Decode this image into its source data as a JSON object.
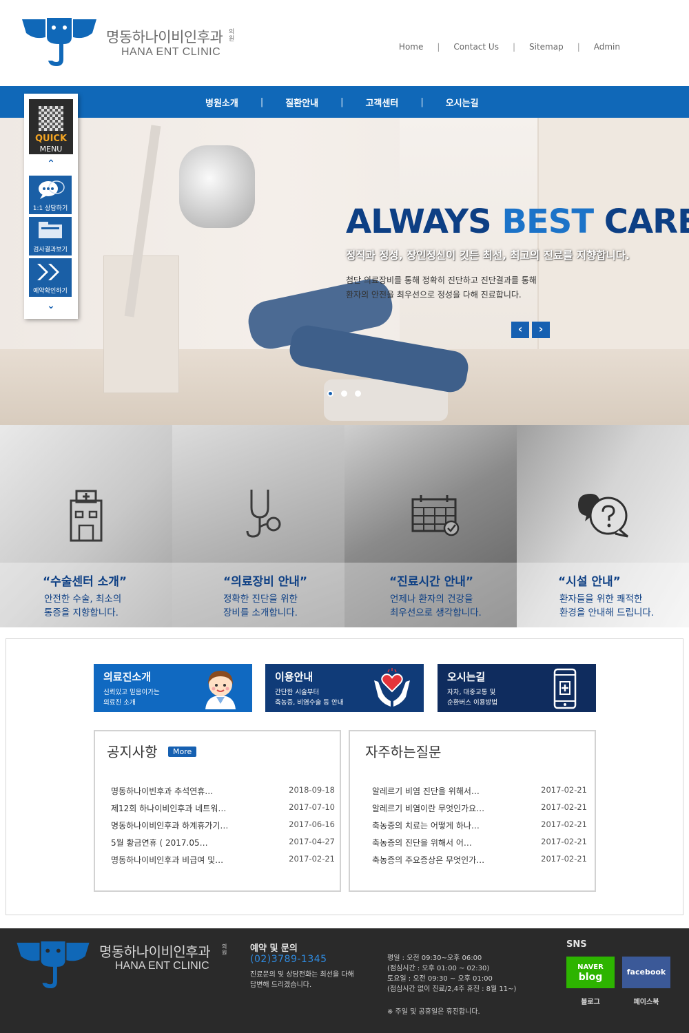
{
  "header": {
    "logo_ko": "명동하나이비인후과",
    "logo_ko_small": "의원",
    "logo_en": "HANA ENT CLINIC",
    "util_nav": [
      "Home",
      "Contact Us",
      "Sitemap",
      "Admin"
    ]
  },
  "main_nav": [
    "병원소개",
    "질환안내",
    "고객센터",
    "오시는길"
  ],
  "hero": {
    "title_part1": "ALWAYS ",
    "title_part2": "BEST",
    "title_part3": " CARE",
    "subtitle": "정직과 정성, 장인정신이 깃든 최선, 최고의 진료를 지향합니다.",
    "description": "첨단 의료장비를 통해 정확히 진단하고 진단결과를 통해\n환자의 안전을 최우선으로 정성을 다해 진료합니다.",
    "prev_icon": "chevron-left-icon",
    "next_icon": "chevron-right-icon",
    "slide_count": 3,
    "active_slide": 1
  },
  "quick_menu": {
    "title_1": "QUICK",
    "title_2": "MENU",
    "items": [
      {
        "label": "1:1 상담하기",
        "icon": "chat-bubble-icon"
      },
      {
        "label": "검사결과보기",
        "icon": "folder-icon"
      },
      {
        "label": "예약확인하기",
        "icon": "double-arrow-icon"
      }
    ]
  },
  "features": [
    {
      "title": "“수술센터 소개”",
      "desc": "안전한 수술, 최소의\n통증을 지향합니다.",
      "icon": "hospital-icon"
    },
    {
      "title": "“의료장비 안내”",
      "desc": "정확한 진단을 위한\n장비를 소개합니다.",
      "icon": "stethoscope-icon"
    },
    {
      "title": "“진료시간 안내”",
      "desc": "언제나 환자의 건강을\n최우선으로 생각합니다.",
      "icon": "calendar-icon"
    },
    {
      "title": "“시설 안내”",
      "desc": "환자들을 위한 쾌적한\n환경을 안내해 드립니다.",
      "icon": "question-bubble-icon"
    }
  ],
  "banners": [
    {
      "title": "의료진소개",
      "sub": "신뢰있고 믿음이가는\n의료진 소개",
      "icon": "doctor-icon"
    },
    {
      "title": "이용안내",
      "sub": "간단한 시술부터\n축농증, 비염수술 등 안내",
      "icon": "heart-hands-icon"
    },
    {
      "title": "오시는길",
      "sub": "자차, 대중교통 및\n순환버스 이용방법",
      "icon": "phone-icon"
    }
  ],
  "notice": {
    "title": "공지사항",
    "more": "More",
    "items": [
      {
        "title": "명동하나이빈후과 추석연휴…",
        "date": "2018-09-18"
      },
      {
        "title": "제12회 하나이비인후과 네트워…",
        "date": "2017-07-10"
      },
      {
        "title": "명동하나이비인후과 하계휴가기…",
        "date": "2017-06-16"
      },
      {
        "title": "5월 황금연휴 ( 2017.05…",
        "date": "2017-04-27"
      },
      {
        "title": "명동하나이비인후과 비급여 및…",
        "date": "2017-02-21"
      }
    ]
  },
  "faq": {
    "title": "자주하는질문",
    "items": [
      {
        "title": "알레르기 비염 진단을 위해서…",
        "date": "2017-02-21"
      },
      {
        "title": "알레르기 비염이란 무엇인가요…",
        "date": "2017-02-21"
      },
      {
        "title": "축농증의 치료는 어떻게 하나…",
        "date": "2017-02-21"
      },
      {
        "title": "축농증의 진단을 위해서 어…",
        "date": "2017-02-21"
      },
      {
        "title": "축농증의 주요증상은 무엇인가…",
        "date": "2017-02-21"
      }
    ]
  },
  "footer": {
    "logo_ko": "명동하나이비인후과",
    "logo_ko_small": "의원",
    "logo_en": "HANA ENT CLINIC",
    "contact_title": "예약 및 문의",
    "phone": "(02)3789-1345",
    "contact_desc": "진료문의 및 상담전화는 최선을 다해\n답변해 드리겠습니다.",
    "hours": "평일 : 오전 09:30~오후 06:00\n(점심시간 : 오후 01:00 ~ 02:30)\n토요일 : 오전 09:30 ~ 오후 01:00\n(점심시간 없이 진료/2,4주 휴진 : 8월 11~)",
    "closed": "※ 주일 및 공휴일은 휴진합니다.",
    "sns_title": "SNS",
    "naver_1": "NAVER",
    "naver_2": "blog",
    "facebook": "facebook",
    "naver_label": "블로그",
    "facebook_label": "페이스북"
  },
  "colors": {
    "brand_blue": "#1068b8",
    "navy": "#0d3f84",
    "footer_bg": "#2a2a2a"
  }
}
